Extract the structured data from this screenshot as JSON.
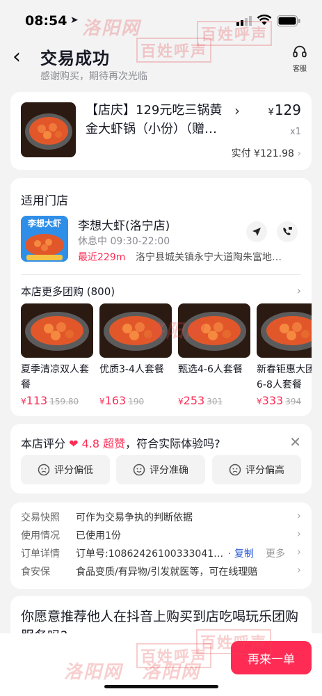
{
  "status_bar": {
    "time": "08:54"
  },
  "header": {
    "title": "交易成功",
    "subtitle": "感谢购买，期待再次光临",
    "service_label": "客服"
  },
  "order": {
    "product_name": "【店庆】129元吃三锅黄金大虾锅（小份）（赠…",
    "currency": "¥",
    "price": "129",
    "quantity": "x1",
    "paid": "实付 ¥121.98"
  },
  "store": {
    "section_title": "适用门店",
    "logo_text": "李想大虾",
    "name": "李想大虾(洛宁店)",
    "hours": "休息中  09:30-22:00",
    "distance": "最近229m",
    "address": "洛宁县城关镇永宁大道陶朱富地…",
    "more_deals_title": "本店更多团购 (800)",
    "deals": [
      {
        "name": "夏季清凉双人套餐",
        "currency": "¥",
        "price": "113",
        "old_price": "159.80"
      },
      {
        "name": "优质3-4人套餐",
        "currency": "¥",
        "price": "163",
        "old_price": "190"
      },
      {
        "name": "甄选4-6人套餐",
        "currency": "¥",
        "price": "253",
        "old_price": "301"
      },
      {
        "name": "新春钜惠大团圆6-8人套餐",
        "currency": "¥",
        "price": "333",
        "old_price": "394"
      }
    ]
  },
  "rating": {
    "prefix": "本店评分",
    "score": "4.8 超赞",
    "suffix": "，符合实际体验吗?",
    "options": [
      "评分偏低",
      "评分准确",
      "评分偏高"
    ]
  },
  "details": [
    {
      "key": "交易快照",
      "value": "可作为交易争执的判断依据"
    },
    {
      "key": "使用情况",
      "value": "已使用1份"
    },
    {
      "key": "订单详情",
      "value": "订单号:10862426100333041…",
      "copy": "· 复制",
      "more": "更多"
    },
    {
      "key": "食安保",
      "value": "食品变质/有异物/引发就医等，可在线理赔"
    }
  ],
  "recommend": {
    "question": "你愿意推荐他人在抖音上购买到店吃喝玩乐团购服务吗?"
  },
  "actions": {
    "buy_again": "再来一单"
  },
  "watermarks": {
    "city": "洛阳网",
    "brand": "百姓呼声"
  },
  "colors": {
    "accent": "#fe2c55",
    "link": "#2a5bd7",
    "background": "#f3f3f4"
  }
}
